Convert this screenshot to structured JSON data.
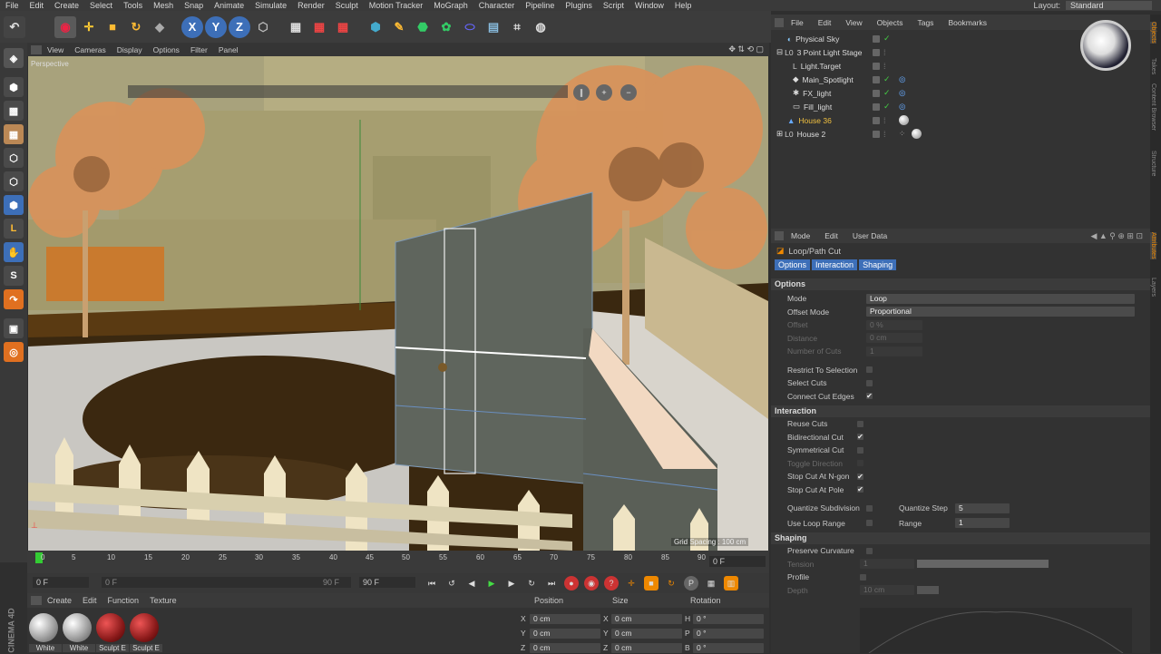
{
  "menubar": {
    "items": [
      "File",
      "Edit",
      "Create",
      "Select",
      "Tools",
      "Mesh",
      "Snap",
      "Animate",
      "Simulate",
      "Render",
      "Sculpt",
      "Motion Tracker",
      "MoGraph",
      "Character",
      "Pipeline",
      "Plugins",
      "Script",
      "Window",
      "Help"
    ],
    "layout_label": "Layout:",
    "layout_value": "Standard"
  },
  "viewport": {
    "menu": [
      "View",
      "Cameras",
      "Display",
      "Options",
      "Filter",
      "Panel"
    ],
    "camera_label": "Perspective",
    "grid_spacing": "Grid Spacing : 100 cm",
    "buttons": [
      "∥",
      "+",
      "−"
    ]
  },
  "timeline": {
    "ticks": [
      "0",
      "5",
      "10",
      "15",
      "20",
      "25",
      "30",
      "35",
      "40",
      "45",
      "50",
      "55",
      "60",
      "65",
      "70",
      "75",
      "80",
      "85",
      "90"
    ],
    "end_frame": "0 F"
  },
  "playbar": {
    "current": "0 F",
    "range_start": "0 F",
    "range_end": "90 F",
    "max": "90 F"
  },
  "materials": {
    "menu": [
      "Create",
      "Edit",
      "Function",
      "Texture"
    ],
    "items": [
      {
        "name": "White",
        "color": "#d0d0d0"
      },
      {
        "name": "White",
        "color": "#d0d0d0"
      },
      {
        "name": "Sculpt E",
        "color": "#8a1a1a"
      },
      {
        "name": "Sculpt E",
        "color": "#8a1a1a"
      }
    ],
    "brand": "CINEMA 4D"
  },
  "coords": {
    "headers": [
      "Position",
      "Size",
      "Rotation"
    ],
    "rows": [
      {
        "a": "X",
        "av": "0 cm",
        "b": "X",
        "bv": "0 cm",
        "c": "H",
        "cv": "0 °"
      },
      {
        "a": "Y",
        "av": "0 cm",
        "b": "Y",
        "bv": "0 cm",
        "c": "P",
        "cv": "0 °"
      },
      {
        "a": "Z",
        "av": "0 cm",
        "b": "Z",
        "bv": "0 cm",
        "c": "B",
        "cv": "0 °"
      }
    ]
  },
  "objects": {
    "menu": [
      "File",
      "Edit",
      "View",
      "Objects",
      "Tags",
      "Bookmarks"
    ],
    "items": [
      {
        "name": "Physical Sky",
        "indent": 0,
        "highlight": false
      },
      {
        "name": "3 Point Light Stage",
        "indent": 0,
        "highlight": false
      },
      {
        "name": "Light.Target",
        "indent": 1,
        "highlight": false
      },
      {
        "name": "Main_Spotlight",
        "indent": 1,
        "highlight": false
      },
      {
        "name": "FX_light",
        "indent": 1,
        "highlight": false
      },
      {
        "name": "Fill_light",
        "indent": 1,
        "highlight": false
      },
      {
        "name": "House 36",
        "indent": 0,
        "highlight": true
      },
      {
        "name": "House 2",
        "indent": 0,
        "highlight": false
      }
    ]
  },
  "attributes": {
    "menu": [
      "Mode",
      "Edit",
      "User Data"
    ],
    "tool_title": "Loop/Path Cut",
    "tabs": [
      "Options",
      "Interaction",
      "Shaping"
    ],
    "options_title": "Options",
    "mode_label": "Mode",
    "mode_value": "Loop",
    "offset_mode_label": "Offset Mode",
    "offset_mode_value": "Proportional",
    "offset_label": "Offset",
    "offset_value": "0 %",
    "distance_label": "Distance",
    "distance_value": "0 cm",
    "cuts_label": "Number of Cuts",
    "cuts_value": "1",
    "restrict_label": "Restrict To Selection",
    "select_cuts_label": "Select Cuts",
    "connect_label": "Connect Cut Edges",
    "interaction_title": "Interaction",
    "reuse_label": "Reuse Cuts",
    "bidir_label": "Bidirectional Cut",
    "symm_label": "Symmetrical Cut",
    "toggle_label": "Toggle Direction",
    "stop_ngon_label": "Stop Cut At N-gon",
    "stop_pole_label": "Stop Cut At Pole",
    "quant_sub_label": "Quantize Subdivision",
    "quant_step_label": "Quantize Step",
    "quant_step_value": "5",
    "loop_range_label": "Use Loop Range",
    "range_label": "Range",
    "range_value": "1",
    "shaping_title": "Shaping",
    "preserve_label": "Preserve Curvature",
    "tension_label": "Tension",
    "tension_value": "1",
    "profile_label": "Profile",
    "depth_label": "Depth",
    "depth_value": "10 cm",
    "check": "✔"
  },
  "sidetabs": [
    "Objects",
    "Takes",
    "Content Browser",
    "Structure",
    "Attributes",
    "Layers"
  ],
  "colors": {
    "accent": "#4a7ec8",
    "highlight_text": "#f0c040"
  }
}
